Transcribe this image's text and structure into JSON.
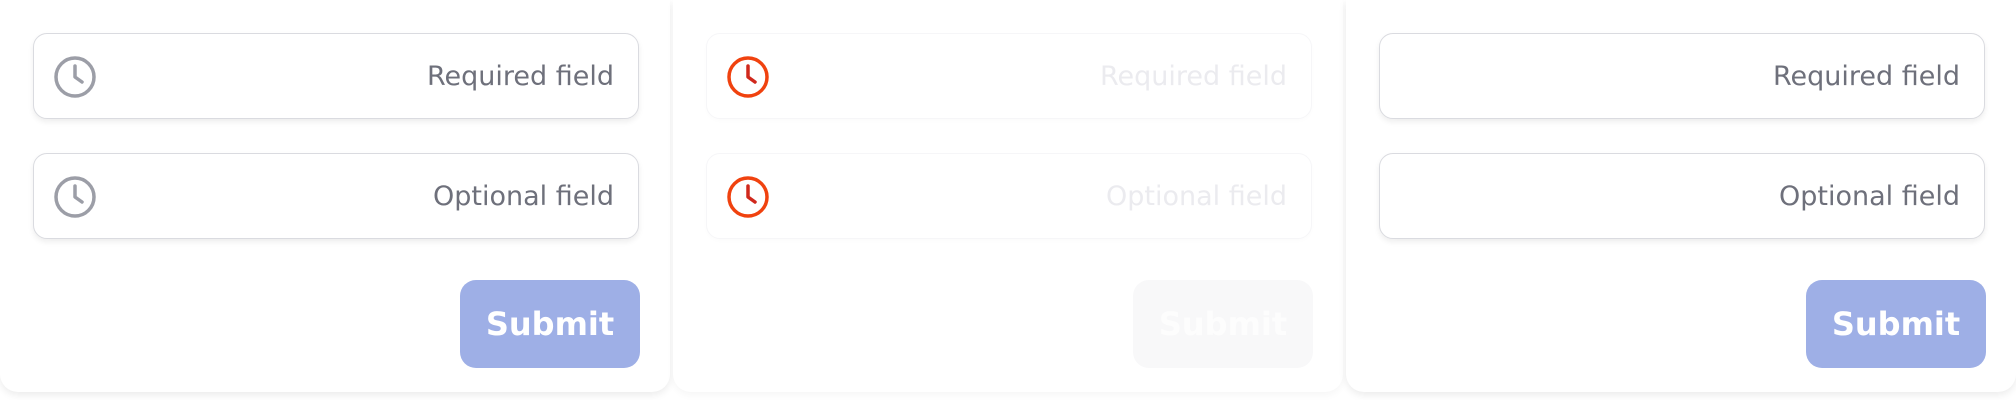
{
  "colors": {
    "submit_bg": "#9eafe6",
    "submit_disabled_bg": "#f8f8f9",
    "field_border": "#dadbe0",
    "label_text": "#6e707b",
    "muted_label_text": "#ebebef",
    "clock_icon_gray": "#9c9ea7",
    "clock_icon_highlight_stroke": "#f0420f",
    "clock_icon_highlight_hands": "#d0281c"
  },
  "icons": {
    "field_icon": "clock-icon"
  },
  "panels": [
    {
      "state": "default",
      "fields": [
        {
          "label": "Required field",
          "icon": "clock-icon"
        },
        {
          "label": "Optional field",
          "icon": "clock-icon"
        }
      ],
      "submit_label": "Submit"
    },
    {
      "state": "disabled",
      "fields": [
        {
          "label": "Required field",
          "icon": "clock-icon"
        },
        {
          "label": "Optional field",
          "icon": "clock-icon"
        }
      ],
      "submit_label": "Submit"
    },
    {
      "state": "no-icon",
      "fields": [
        {
          "label": "Required field"
        },
        {
          "label": "Optional field"
        }
      ],
      "submit_label": "Submit"
    }
  ]
}
